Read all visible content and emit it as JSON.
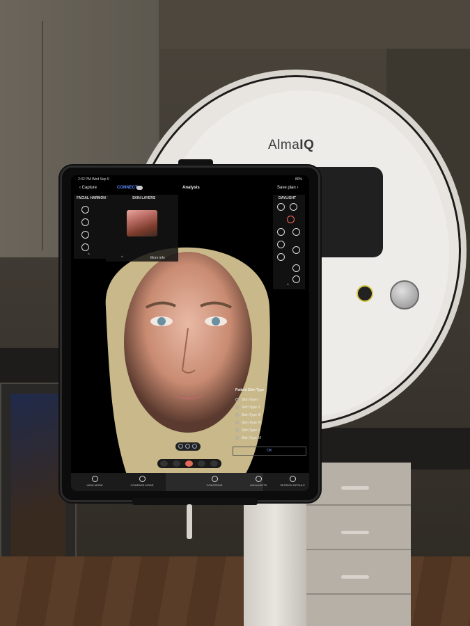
{
  "device": {
    "brand_regular": "Alma",
    "brand_bold": "IQ"
  },
  "statusbar": {
    "time": "2:32 PM  Wed Sep 9",
    "battery": "80%"
  },
  "navbar": {
    "back_label": "Capture",
    "connect_label": "CONNECT",
    "title": "Analysis",
    "save_label": "Save plan"
  },
  "panels": {
    "facial_harmony": "FACIAL HARMONY",
    "skin_layers": "SKIN LAYERS",
    "more_info": "More info",
    "daylight": "DAYLIGHT"
  },
  "skin_type": {
    "title": "Patient Skin Type",
    "options": [
      "Skin Type I",
      "Skin Type II",
      "Skin Type III",
      "Skin Type IV",
      "Skin Type V",
      "Skin Type VI"
    ],
    "ok_label": "OK"
  },
  "tabs": [
    "VIEW MODE",
    "COMPARE MODE",
    "CONCERNS",
    "HIGHLIGHTS",
    "SESSION DETAILS"
  ],
  "colors": {
    "accent": "#5a8cff",
    "screen_bg": "#000000"
  }
}
